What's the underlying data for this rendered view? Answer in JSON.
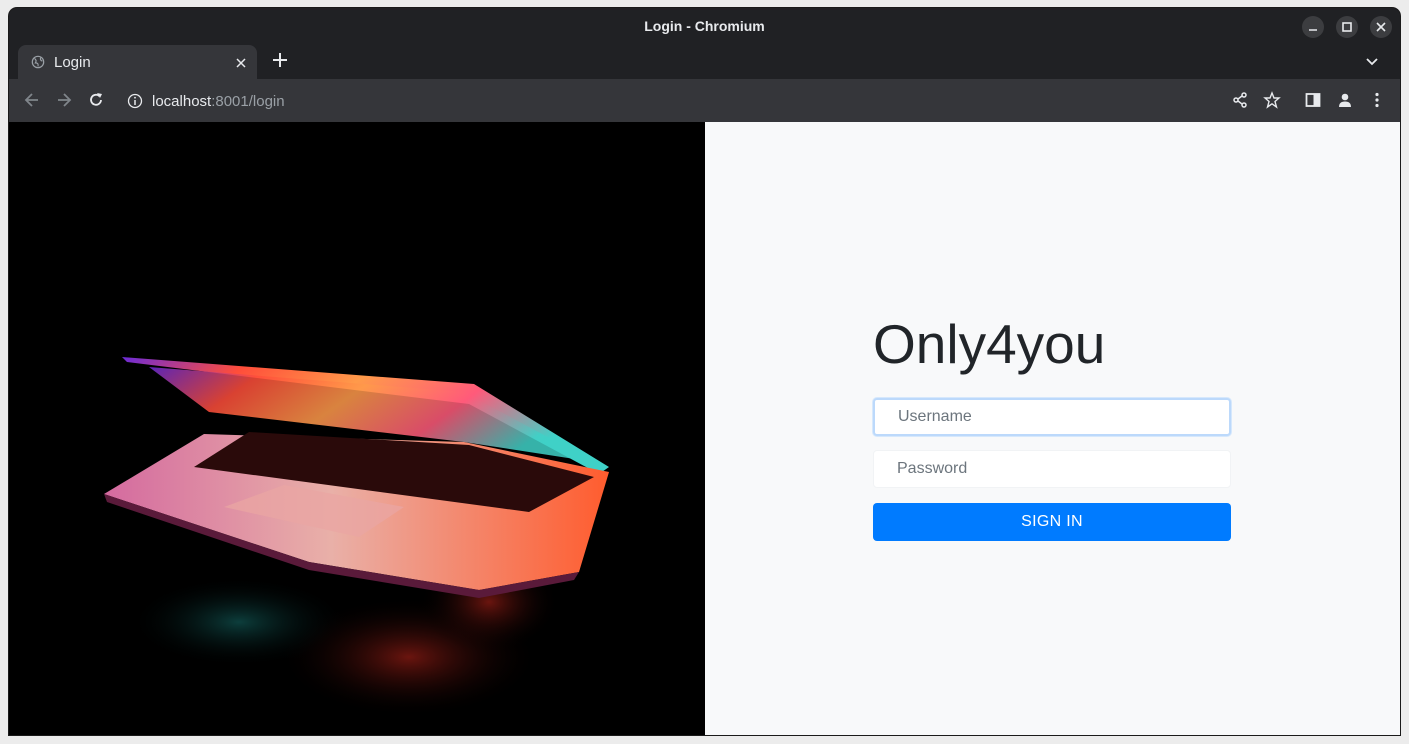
{
  "window": {
    "title": "Login - Chromium"
  },
  "tabs": [
    {
      "label": "Login",
      "active": true
    }
  ],
  "toolbar": {
    "url_host": "localhost",
    "url_rest": ":8001/login"
  },
  "page": {
    "brand": "Only4you",
    "username_placeholder": "Username",
    "password_placeholder": "Password",
    "signin_label": "SIGN IN"
  },
  "colors": {
    "primary_button": "#007bff",
    "page_background": "#f8f9fa",
    "hero_background": "#000000",
    "browser_chrome": "#35363a"
  },
  "icons": {
    "tab_favicon": "globe-icon",
    "new_tab": "plus-icon",
    "tab_close": "close-icon",
    "tab_search": "chevron-down-icon",
    "back": "arrow-left-icon",
    "forward": "arrow-right-icon",
    "reload": "reload-icon",
    "site_info": "info-icon",
    "share": "share-icon",
    "bookmark": "star-icon",
    "side_panel": "side-panel-icon",
    "profile": "person-icon",
    "menu": "kebab-menu-icon"
  }
}
